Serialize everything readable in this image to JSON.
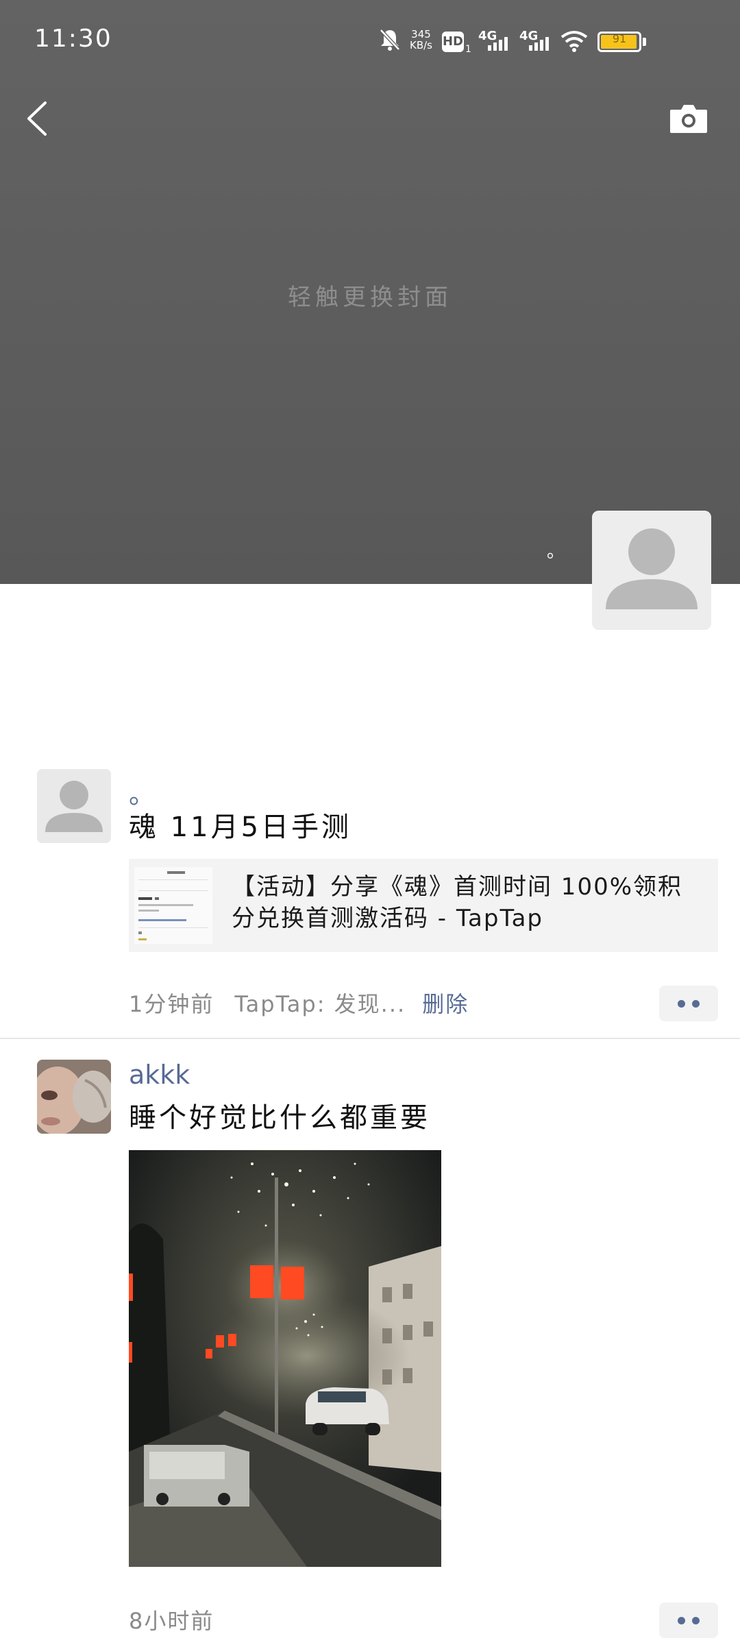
{
  "status_bar": {
    "time": "11:30",
    "net_speed_value": "345",
    "net_speed_unit": "KB/s",
    "hd_label": "HD",
    "hd_sub": "1",
    "sim1_label": "4G",
    "sim2_label": "4G",
    "battery_level": "91",
    "icons": [
      "mute-bell-icon",
      "hd-icon",
      "signal-icon",
      "signal-icon",
      "wifi-icon",
      "battery-icon"
    ]
  },
  "header": {
    "back_icon": "chevron-left-icon",
    "camera_icon": "camera-icon",
    "cover_hint": "轻触更换封面",
    "profile_name": "。"
  },
  "posts": [
    {
      "author": "。",
      "text": "魂 11月5日手测",
      "link_title": "【活动】分享《魂》首测时间 100%领积分兑换首测激活码 - TapTap",
      "time": "1分钟前",
      "source": "TapTap: 发现...",
      "delete_label": "删除"
    },
    {
      "author": "akkk",
      "text": "睡个好觉比什么都重要",
      "time": "8小时前"
    }
  ],
  "colors": {
    "cover_bg": "#5e5e5e",
    "link_blue": "#576b95",
    "battery": "#f6c21c"
  }
}
